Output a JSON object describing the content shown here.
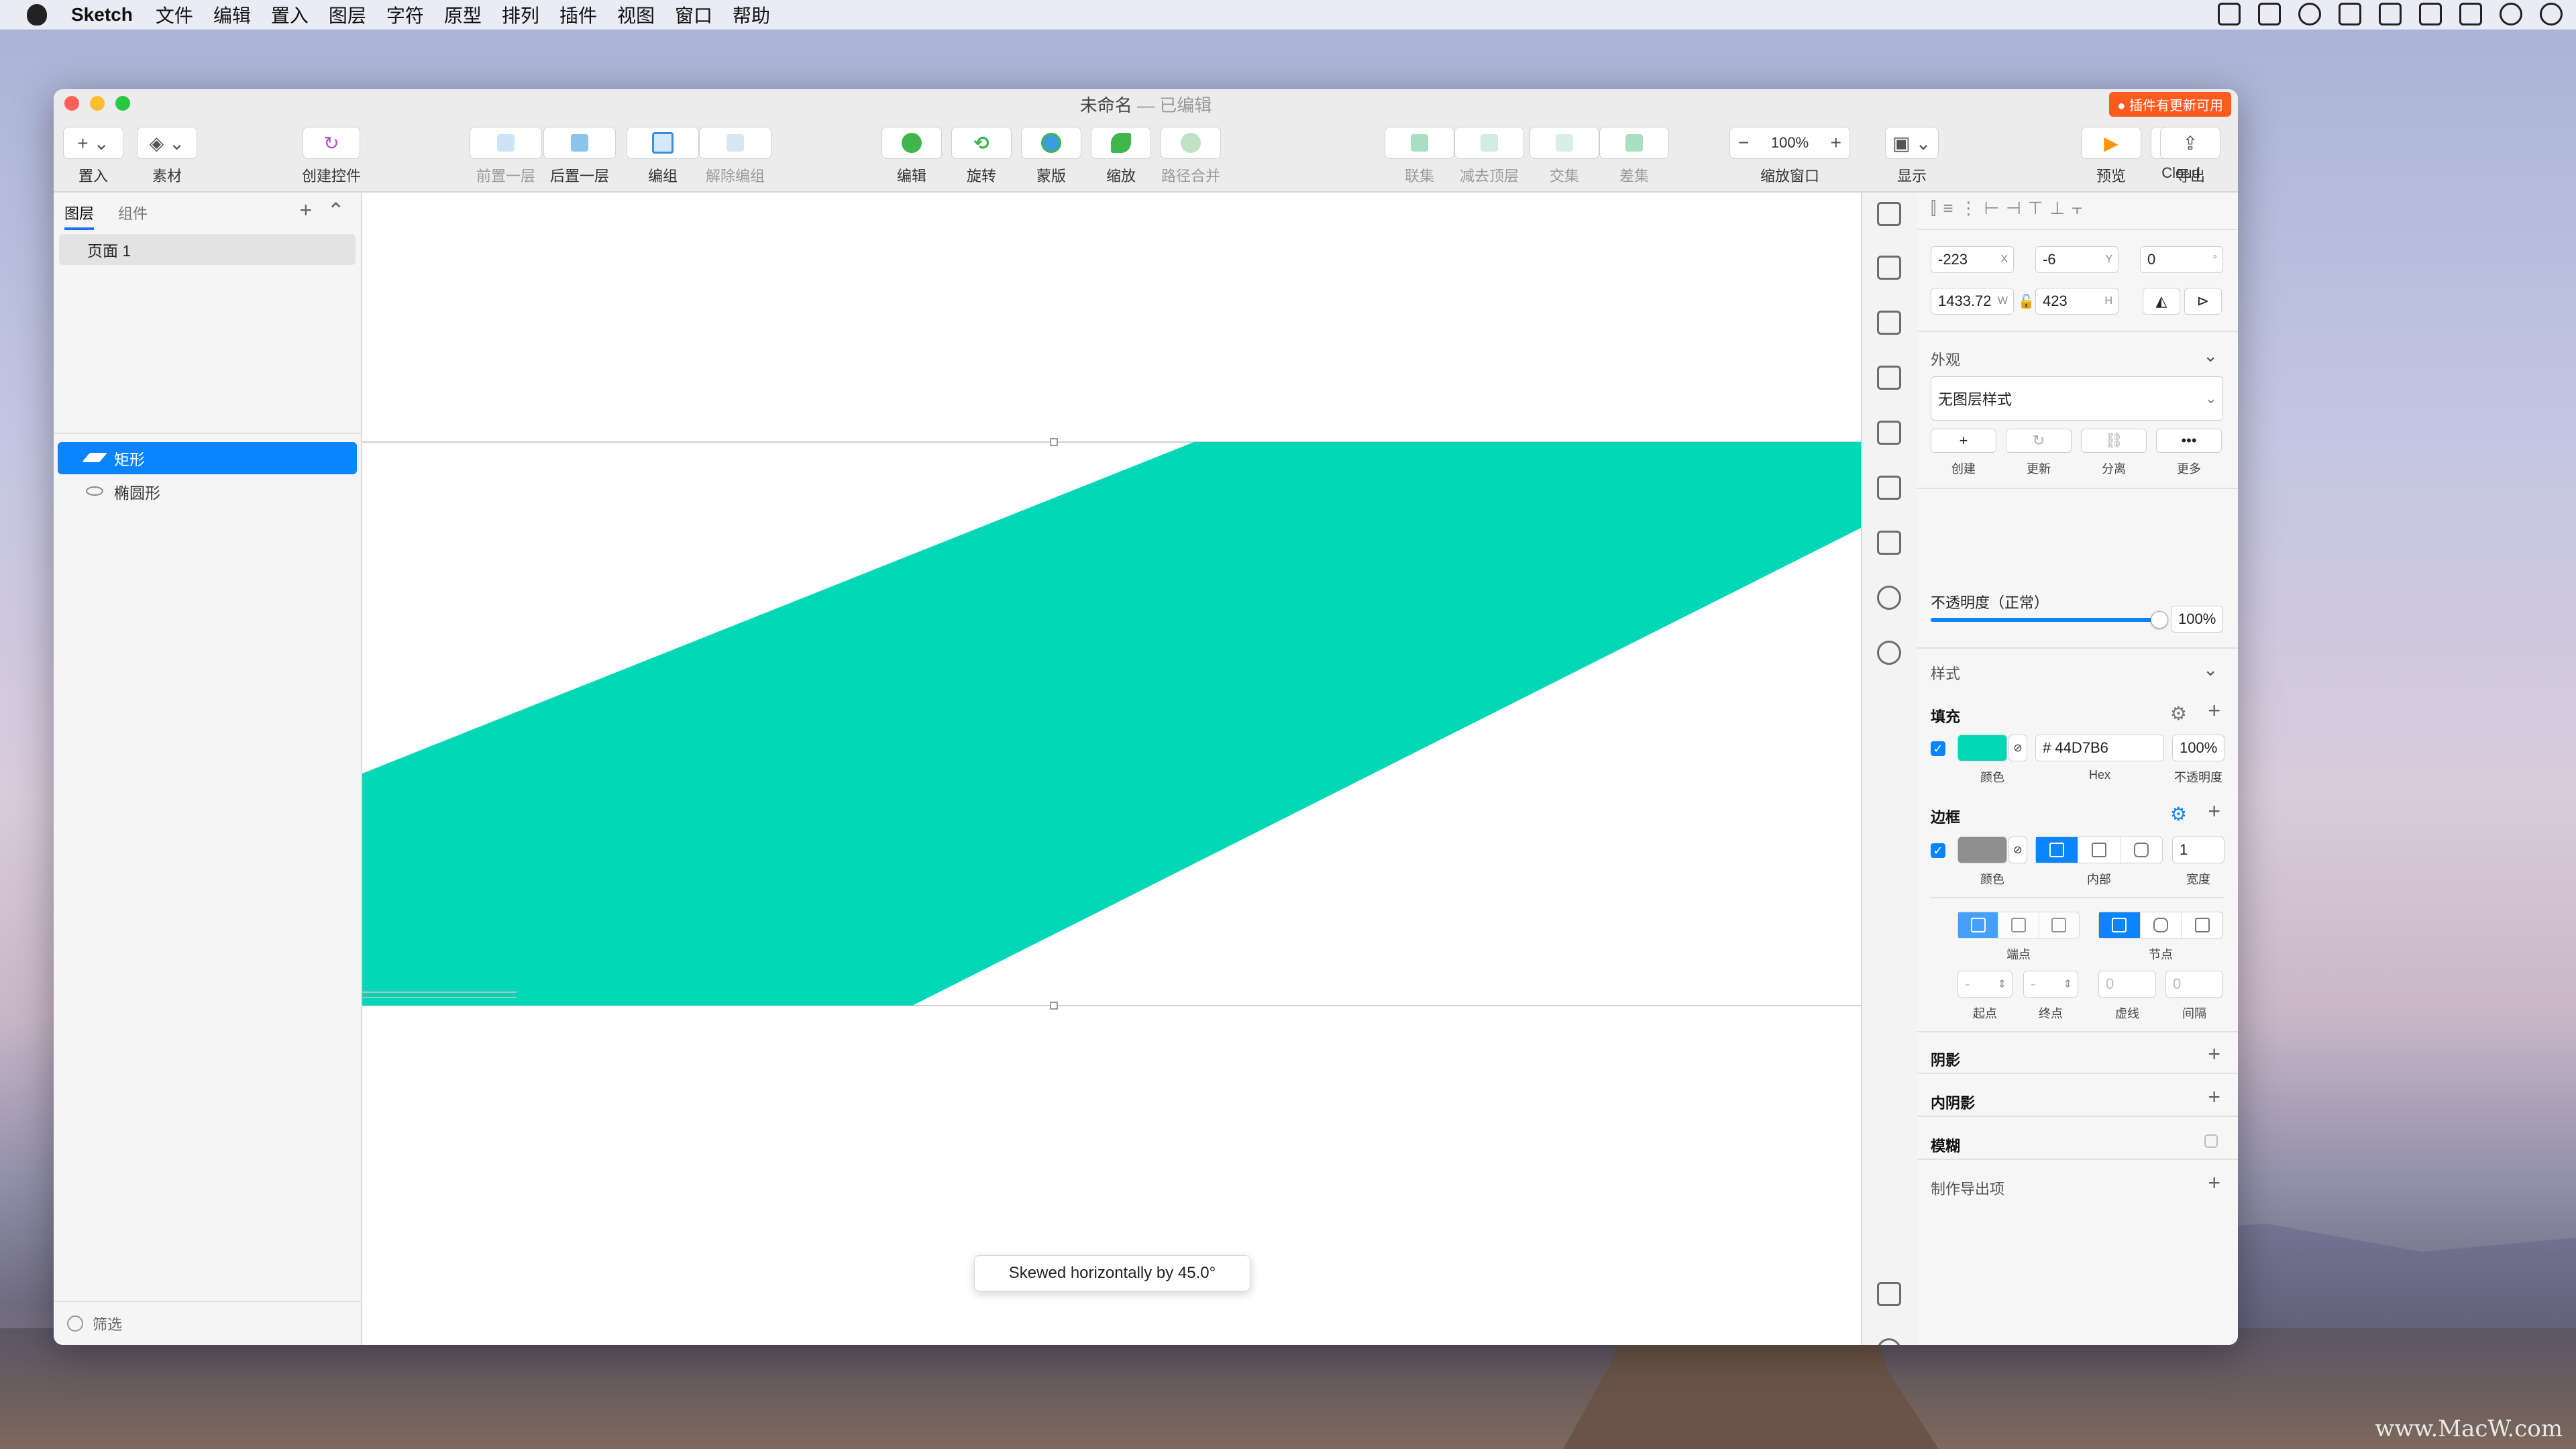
{
  "menubar": {
    "app_name": "Sketch",
    "items": [
      "文件",
      "编辑",
      "置入",
      "图层",
      "字符",
      "原型",
      "排列",
      "插件",
      "视图",
      "窗口",
      "帮助"
    ]
  },
  "window": {
    "title": "未命名",
    "edited": " — 已编辑",
    "plugin_badge": "● 插件有更新可用"
  },
  "toolbar": {
    "insert": "置入",
    "assets": "素材",
    "create_symbol": "创建控件",
    "forward": "前置一层",
    "backward": "后置一层",
    "group": "编组",
    "ungroup": "解除编组",
    "edit": "编辑",
    "rotate": "旋转",
    "mask": "蒙版",
    "scale": "缩放",
    "flatten": "路径合并",
    "union": "联集",
    "subtract": "减去顶层",
    "intersect": "交集",
    "difference": "差集",
    "zoom_value": "100%",
    "zoom_label": "缩放窗口",
    "view": "显示",
    "preview": "预览",
    "cloud": "Cloud",
    "export": "导出"
  },
  "left_panel": {
    "tab_layers": "图层",
    "tab_components": "组件",
    "page": "页面 1",
    "layers": [
      {
        "name": "矩形",
        "selected": true
      },
      {
        "name": "椭圆形",
        "selected": false
      }
    ],
    "filter": "筛选"
  },
  "canvas": {
    "shape_color": "#00D7B6",
    "toast": "Skewed horizontally by 45.0°"
  },
  "inspector": {
    "x": "-223",
    "x_label": "X",
    "y": "-6",
    "y_label": "Y",
    "rotation": "0",
    "rotation_unit": "°",
    "w": "1433.72",
    "w_label": "W",
    "h": "423",
    "h_label": "H",
    "appearance_title": "外观",
    "style_select": "无图层样式",
    "style_actions": [
      "创建",
      "更新",
      "分离",
      "更多"
    ],
    "opacity_label": "不透明度（正常）",
    "opacity_value": "100%",
    "opacity_fraction": 1.0,
    "style_title": "样式",
    "fill_title": "填充",
    "fill_color": "#00D7B6",
    "fill_hex": "# 44D7B6",
    "fill_opacity": "100%",
    "fill_color_label": "颜色",
    "fill_hex_label": "Hex",
    "fill_opacity_label": "不透明度",
    "border_title": "边框",
    "border_color": "#8E8E8E",
    "border_width": "1",
    "border_color_label": "颜色",
    "border_position_label": "内部",
    "border_width_label": "宽度",
    "ends_label": "端点",
    "joins_label": "节点",
    "start_label": "起点",
    "end_label": "终点",
    "dash_value": "0",
    "gap_value": "0",
    "dash_label": "虚线",
    "gap_label": "间隔",
    "shadow_title": "阴影",
    "inner_shadow_title": "内阴影",
    "blur_title": "模糊",
    "export_title": "制作导出项"
  },
  "desktop": {
    "watermark": "www.MacW.com"
  }
}
